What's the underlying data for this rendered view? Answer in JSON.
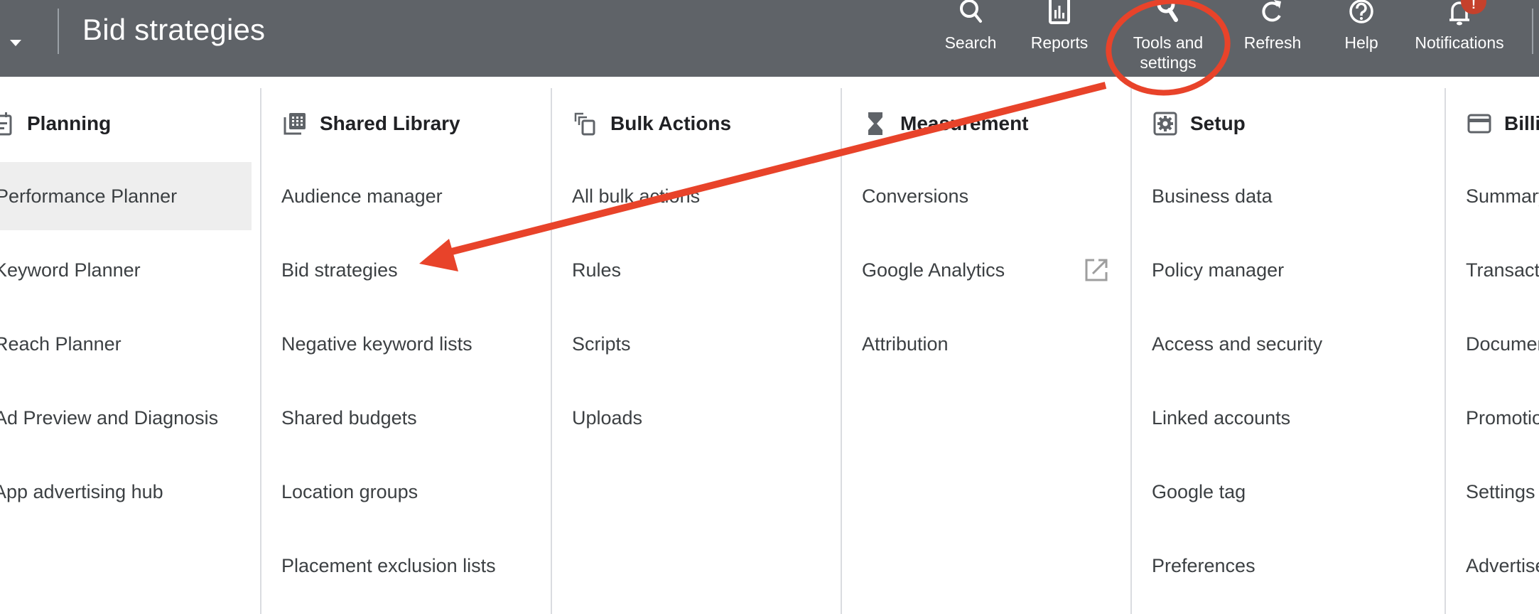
{
  "header": {
    "title": "Bid strategies",
    "buttons": [
      {
        "label": "Search",
        "icon": "search-icon"
      },
      {
        "label": "Reports",
        "icon": "bar-chart-icon"
      },
      {
        "label_line1": "Tools and",
        "label_line2": "settings",
        "icon": "wrench-icon"
      },
      {
        "label": "Refresh",
        "icon": "refresh-icon"
      },
      {
        "label": "Help",
        "icon": "help-icon"
      },
      {
        "label": "Notifications",
        "icon": "bell-icon"
      }
    ],
    "notification_badge": "!"
  },
  "menu": {
    "columns": [
      {
        "title": "Planning",
        "icon": "planning-calendar-icon",
        "items": [
          "Performance Planner",
          "Keyword Planner",
          "Reach Planner",
          "Ad Preview and Diagnosis",
          "App advertising hub"
        ],
        "selected_index": 0
      },
      {
        "title": "Shared Library",
        "icon": "library-icon",
        "items": [
          "Audience manager",
          "Bid strategies",
          "Negative keyword lists",
          "Shared budgets",
          "Location groups",
          "Placement exclusion lists"
        ]
      },
      {
        "title": "Bulk Actions",
        "icon": "bulk-actions-icon",
        "items": [
          "All bulk actions",
          "Rules",
          "Scripts",
          "Uploads"
        ]
      },
      {
        "title": "Measurement",
        "icon": "hourglass-icon",
        "items": [
          "Conversions",
          "Google Analytics",
          "Attribution"
        ],
        "external_link_item_index": 1
      },
      {
        "title": "Setup",
        "icon": "setup-gear-icon",
        "items": [
          "Business data",
          "Policy manager",
          "Access and security",
          "Linked accounts",
          "Google tag",
          "Preferences"
        ]
      },
      {
        "title": "Billing",
        "icon": "credit-card-icon",
        "items": [
          "Summary",
          "Transactions",
          "Documents",
          "Promotions",
          "Settings",
          "Advertiser verification"
        ]
      }
    ]
  },
  "annotation": {
    "color": "#e8432a",
    "highlight_target": "Tools and settings",
    "arrow_target": "Bid strategies"
  }
}
